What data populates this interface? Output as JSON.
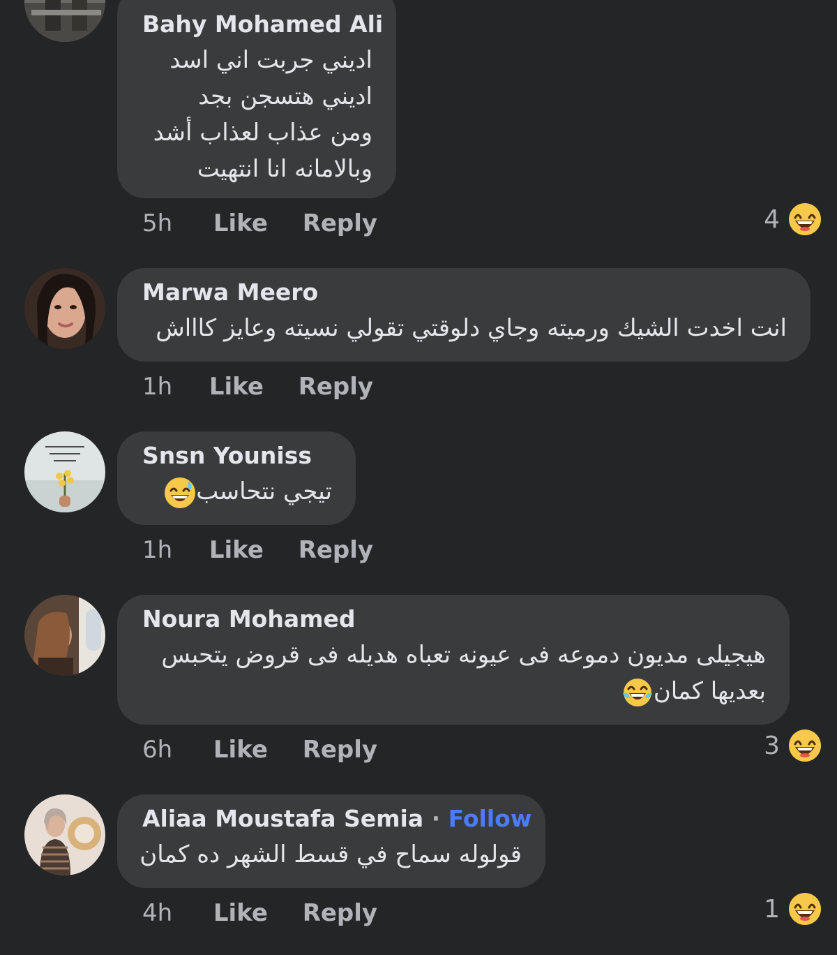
{
  "comments": [
    {
      "author": "Bahy Mohamed Ali",
      "lines": [
        "اديني جربت اني اسد",
        "اديني هتسجن بجد",
        "ومن عذاب لعذاب أشد",
        "وبالامانه انا انتهيت"
      ],
      "time": "5h",
      "like": "Like",
      "reply": "Reply",
      "reaction_count": "4",
      "reaction_icon": "grinning-face-emoji"
    },
    {
      "author": "Marwa Meero",
      "lines": [
        "انت اخدت الشيك ورميته وجاي دلوقتي تقولي نسيته وعايز كاااش"
      ],
      "time": "1h",
      "like": "Like",
      "reply": "Reply"
    },
    {
      "author": "Snsn Youniss",
      "lines": [
        "تيجي نتحاسب"
      ],
      "inline_emoji": "sweat-smile-emoji",
      "time": "1h",
      "like": "Like",
      "reply": "Reply"
    },
    {
      "author": "Noura Mohamed",
      "lines": [
        "هيجيلى مديون دموعه فى عيونه تعباه هديله فى قروض يتحبس",
        "بعديها كمان"
      ],
      "inline_emoji": "tears-of-joy-emoji",
      "time": "6h",
      "like": "Like",
      "reply": "Reply",
      "reaction_count": "3",
      "reaction_icon": "grinning-face-emoji"
    },
    {
      "author": "Aliaa Moustafa Semia",
      "follow_sep": "·",
      "follow": "Follow",
      "lines": [
        "قولوله سماح في قسط الشهر ده كمان"
      ],
      "time": "4h",
      "like": "Like",
      "reply": "Reply",
      "reaction_count": "1",
      "reaction_icon": "grinning-face-emoji"
    }
  ],
  "colors": {
    "background": "#242526",
    "bubble": "#3a3b3c",
    "text": "#e4e6eb",
    "secondary": "#b0b3b8",
    "follow": "#4b7bff"
  }
}
